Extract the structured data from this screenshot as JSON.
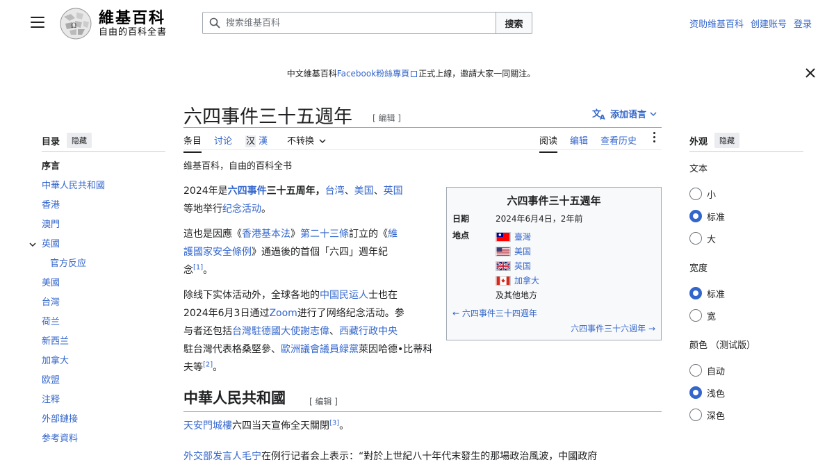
{
  "header": {
    "logo_title": "維基百科",
    "logo_subtitle": "自由的百科全書",
    "search_placeholder": "搜索维基百科",
    "search_button": "搜索",
    "user_links": [
      "资助维基百科",
      "创建账号",
      "登录"
    ]
  },
  "notice": {
    "prefix": "中文維基百科",
    "link": "Facebook粉絲專頁",
    "suffix": "正式上線，邀請大家一同關注。"
  },
  "page": {
    "title": "六四事件三十五週年",
    "edit_label": "[ 编辑 ]",
    "add_languages": "添加语言",
    "tabs_left": [
      "条目",
      "讨论"
    ],
    "variant_1": "汉",
    "variant_2": "漢",
    "variant_menu": "不转换",
    "tabs_right": [
      "阅读",
      "编辑",
      "查看历史"
    ],
    "tagline": "维基百科，自由的百科全书"
  },
  "toc": {
    "title": "目录",
    "hide": "隐藏",
    "items": [
      {
        "label": "序言",
        "level": 0
      },
      {
        "label": "中華人民共和國",
        "level": 0
      },
      {
        "label": "香港",
        "level": 0
      },
      {
        "label": "澳門",
        "level": 0
      },
      {
        "label": "英國",
        "level": 0
      },
      {
        "label": "官方反应",
        "level": 1
      },
      {
        "label": "美國",
        "level": 0
      },
      {
        "label": "台灣",
        "level": 0
      },
      {
        "label": "荷兰",
        "level": 0
      },
      {
        "label": "新西兰",
        "level": 0
      },
      {
        "label": "加拿大",
        "level": 0
      },
      {
        "label": "欧盟",
        "level": 0
      },
      {
        "label": "注释",
        "level": 0
      },
      {
        "label": "外部鏈接",
        "level": 0
      },
      {
        "label": "参考資料",
        "level": 0
      }
    ]
  },
  "article": {
    "p1": {
      "a": "2024年是",
      "b": "六四事件",
      "c": "三十五周年，",
      "d": "台湾",
      "e": "、",
      "f": "美国",
      "g": "、",
      "h": "英国",
      "i": "等地举行",
      "j": "纪念活动",
      "k": "。"
    },
    "p2": {
      "a": "這也是因應《",
      "b": "香港基本法",
      "c": "》",
      "d": "第二十三條",
      "e": "訂立的《",
      "f": "維",
      "g": "護國家安全條例",
      "h": "》通過後的首個「六四」週年紀",
      "i": "念",
      "ref": "[1]",
      "j": "。"
    },
    "p3": {
      "a": "除线下实体活动外，全球各地的",
      "b": "中国民运人",
      "c": "士也在",
      "d": "2024年6月3日通过",
      "e": "Zoom",
      "f": "进行了网络纪念活动。参",
      "g": "与者还包括",
      "h": "台灣駐德國大使謝志偉",
      "i": "、",
      "j": "西藏行政中央",
      "k": "駐台灣代表格桑堅參",
      "l": "、",
      "m": "歐洲議會議員緑黨",
      "n": "萊因哈德•比蒂科夫等",
      "ref": "[2]",
      "o": "。"
    }
  },
  "infobox": {
    "title": "六四事件三十五週年",
    "date_label": "日期",
    "date_value": "2024年6月4日，2年前",
    "place_label": "地点",
    "places": [
      "臺灣",
      "美国",
      "英国",
      "加拿大"
    ],
    "other": "及其他地方",
    "prev": "← 六四事件三十四週年",
    "next": "六四事件三十六週年 →"
  },
  "section2": {
    "heading": "中華人民共和國",
    "edit_label": "[ 编辑 ]",
    "p1_link": "天安門城樓",
    "p1_text": "六四当天宣佈全天關閉",
    "p1_ref": "[3]",
    "p1_end": "。",
    "p2_link": "外交部发言人毛宁",
    "p2_text": "在例行记者会上表示：“對於上世紀八十年代末發生的那場政治風波，中國政府"
  },
  "appearance": {
    "title": "外观",
    "hide": "隐藏",
    "text_label": "文本",
    "text_options": [
      "小",
      "标准",
      "大"
    ],
    "text_selected": 1,
    "width_label": "宽度",
    "width_options": [
      "标准",
      "宽"
    ],
    "width_selected": 0,
    "color_label": "颜色 （测试版）",
    "color_options": [
      "自动",
      "浅色",
      "深色"
    ],
    "color_selected": 1
  },
  "colors": {
    "link": "#3366cc",
    "text": "#202122",
    "border": "#a2a9b1"
  }
}
